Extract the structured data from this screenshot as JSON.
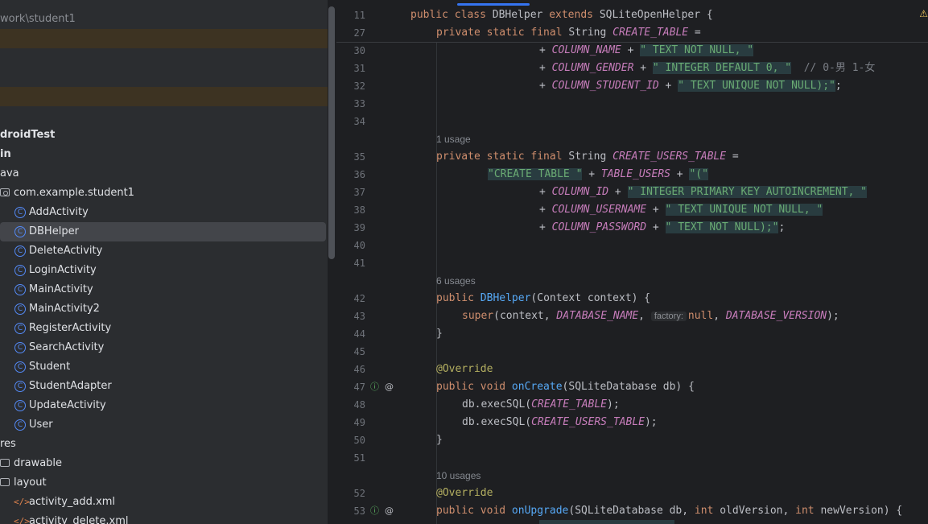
{
  "project": {
    "path_fragment": "work\\student1",
    "items": [
      {
        "label": "droidTest"
      },
      {
        "label": "in"
      },
      {
        "label": "ava"
      },
      {
        "label": "com.example.student1"
      },
      {
        "label": "AddActivity"
      },
      {
        "label": "DBHelper"
      },
      {
        "label": "DeleteActivity"
      },
      {
        "label": "LoginActivity"
      },
      {
        "label": "MainActivity"
      },
      {
        "label": "MainActivity2"
      },
      {
        "label": "RegisterActivity"
      },
      {
        "label": "SearchActivity"
      },
      {
        "label": "Student"
      },
      {
        "label": "StudentAdapter"
      },
      {
        "label": "UpdateActivity"
      },
      {
        "label": "User"
      },
      {
        "label": "res"
      },
      {
        "label": "drawable"
      },
      {
        "label": "layout"
      },
      {
        "label": "activity_add.xml"
      },
      {
        "label": "activity_delete.xml"
      }
    ]
  },
  "editor": {
    "line_numbers": [
      "11",
      "27",
      "30",
      "31",
      "32",
      "33",
      "34",
      "35",
      "36",
      "37",
      "38",
      "39",
      "40",
      "41",
      "42",
      "43",
      "44",
      "45",
      "46",
      "47",
      "48",
      "49",
      "50",
      "51",
      "52",
      "53"
    ],
    "usages": [
      "1 usage",
      "6 usages",
      "10 usages"
    ],
    "inlay_factory": "factory:",
    "code": {
      "l11_a": "public class ",
      "l11_b": "DBHelper ",
      "l11_c": "extends ",
      "l11_d": "SQLiteOpenHelper {",
      "l27_a": "private static final ",
      "l27_b": "String ",
      "l27_c": "CREATE_TABLE",
      "l27_d": " =",
      "l30_a": "+ ",
      "l30_b": "COLUMN_NAME",
      "l30_c": " + ",
      "l30_d": "\" TEXT NOT NULL, \"",
      "l31_a": "+ ",
      "l31_b": "COLUMN_GENDER",
      "l31_c": " + ",
      "l31_d": "\" INTEGER DEFAULT 0, \"",
      "l31_e": "  // 0-男 1-女",
      "l32_a": "+ ",
      "l32_b": "COLUMN_STUDENT_ID",
      "l32_c": " + ",
      "l32_d": "\" TEXT UNIQUE NOT NULL);\"",
      "l32_e": ";",
      "l35_a": "private static final ",
      "l35_b": "String ",
      "l35_c": "CREATE_USERS_TABLE",
      "l35_d": " =",
      "l36_a": "\"CREATE TABLE \"",
      "l36_b": " + ",
      "l36_c": "TABLE_USERS",
      "l36_d": " + ",
      "l36_e": "\"(\"",
      "l37_a": "+ ",
      "l37_b": "COLUMN_ID",
      "l37_c": " + ",
      "l37_d": "\" INTEGER PRIMARY KEY AUTOINCREMENT, \"",
      "l38_a": "+ ",
      "l38_b": "COLUMN_USERNAME",
      "l38_c": " + ",
      "l38_d": "\" TEXT UNIQUE NOT NULL, \"",
      "l39_a": "+ ",
      "l39_b": "COLUMN_PASSWORD",
      "l39_c": " + ",
      "l39_d": "\" TEXT NOT NULL);\"",
      "l39_e": ";",
      "l42_a": "public ",
      "l42_b": "DBHelper",
      "l42_c": "(Context context) {",
      "l43_a": "super",
      "l43_b": "(context, ",
      "l43_c": "DATABASE_NAME",
      "l43_d": ", ",
      "l43_e": "null",
      "l43_f": ", ",
      "l43_g": "DATABASE_VERSION",
      "l43_h": ");",
      "l44": "}",
      "l46": "@Override",
      "l47_a": "public void ",
      "l47_b": "onCreate",
      "l47_c": "(SQLiteDatabase db) {",
      "l48_a": "db.execSQL(",
      "l48_b": "CREATE_TABLE",
      "l48_c": ");",
      "l49_a": "db.execSQL(",
      "l49_b": "CREATE_USERS_TABLE",
      "l49_c": ");",
      "l50": "}",
      "l52": "@Override",
      "l53_a": "public void ",
      "l53_b": "onUpgrade",
      "l53_c": "(SQLiteDatabase db, ",
      "l53_d": "int ",
      "l53_e": "oldVersion, ",
      "l53_f": "int ",
      "l53_g": "newVersion) {"
    }
  },
  "colors": {
    "keyword": "#cf8e6d",
    "constant": "#c77dbb",
    "string": "#6aab73",
    "function": "#56a8f5",
    "annotation": "#b3ae60",
    "number": "#2aacb8",
    "selection": "#3574f0"
  },
  "icons": [
    "class-icon",
    "folder-icon",
    "package-icon",
    "xml-file-icon",
    "implements-icon",
    "override-icon",
    "warning-icon"
  ]
}
